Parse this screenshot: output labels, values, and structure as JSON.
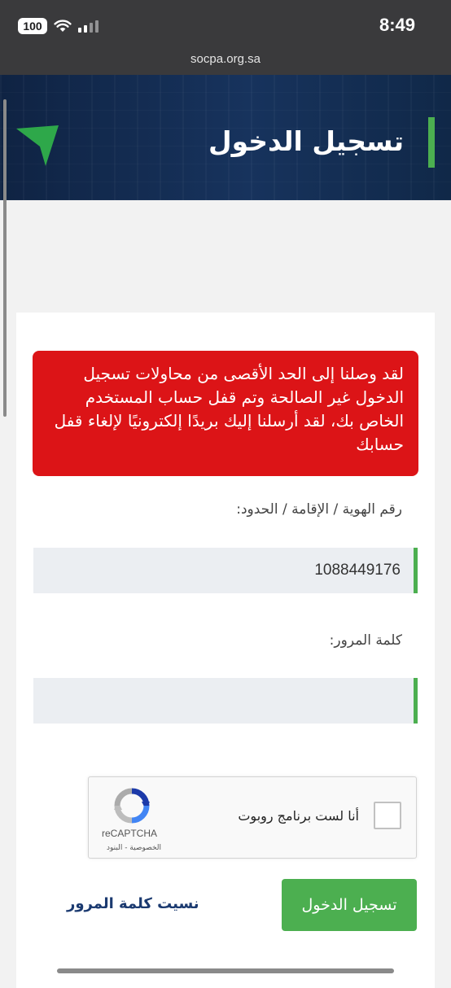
{
  "status_bar": {
    "battery": "100",
    "time": "8:49"
  },
  "browser": {
    "url": "socpa.org.sa"
  },
  "header": {
    "title": "تسجيل الدخول",
    "accent_color": "#4caf50"
  },
  "alert": {
    "message": "لقد وصلنا إلى الحد الأقصى من محاولات تسجيل الدخول غير الصالحة وتم قفل حساب المستخدم الخاص بك، لقد أرسلنا إليك بريدًا إلكترونيًا لإلغاء قفل حسابك",
    "color": "#dc1417"
  },
  "form": {
    "id_label": "رقم الهوية / الإقامة / الحدود:",
    "id_value": "1088449176",
    "password_label": "كلمة المرور:",
    "password_value": ""
  },
  "recaptcha": {
    "checkbox_label": "أنا لست برنامج روبوت",
    "brand": "reCAPTCHA",
    "links": "الخصوصية - البنود"
  },
  "actions": {
    "login_label": "تسجيل الدخول",
    "forgot_label": "نسيت كلمة المرور",
    "button_color": "#4caf50"
  }
}
